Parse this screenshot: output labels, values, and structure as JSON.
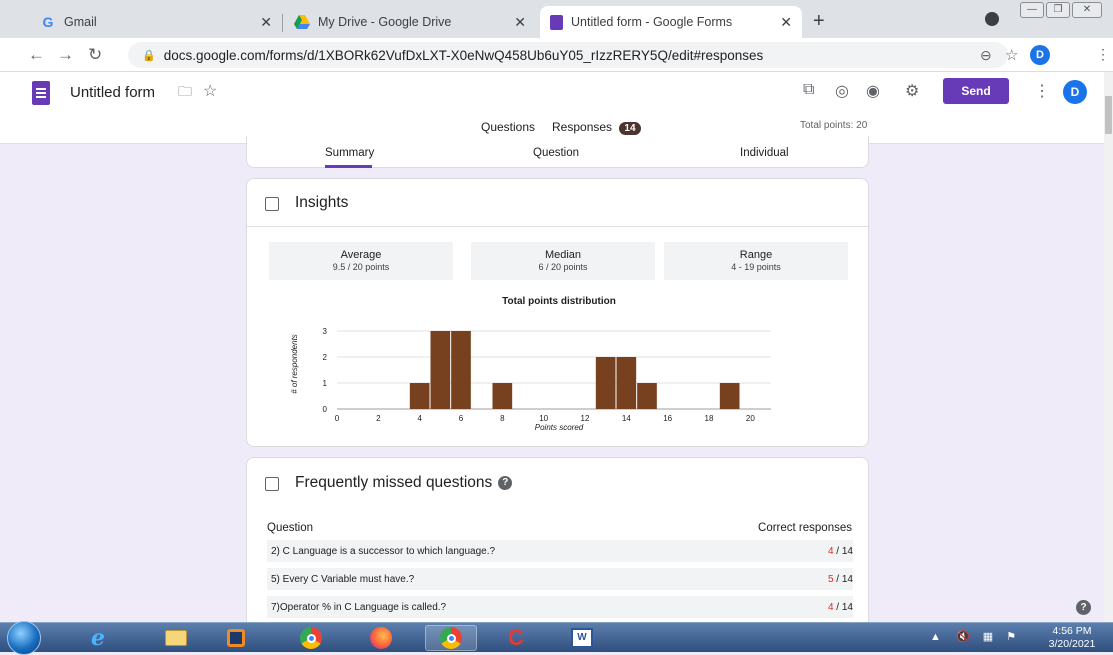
{
  "browser": {
    "tabs": [
      {
        "title": "Gmail"
      },
      {
        "title": "My Drive - Google Drive"
      },
      {
        "title": "Untitled form - Google Forms"
      }
    ],
    "url": "docs.google.com/forms/d/1XBORk62VufDxLXT-X0eNwQ458Ub6uY05_rIzzRERY5Q/edit#responses",
    "profile_initial": "D"
  },
  "forms_header": {
    "form_title": "Untitled form",
    "send_label": "Send",
    "profile_initial": "D",
    "tabs": {
      "questions": "Questions",
      "responses": "Responses",
      "responses_count": "14"
    },
    "total_points": "Total points: 20"
  },
  "response_tabs": {
    "summary": "Summary",
    "question": "Question",
    "individual": "Individual"
  },
  "insights": {
    "title": "Insights",
    "stats": [
      {
        "label": "Average",
        "value": "9.5 / 20 points"
      },
      {
        "label": "Median",
        "value": "6 / 20 points"
      },
      {
        "label": "Range",
        "value": "4 - 19 points"
      }
    ]
  },
  "chart_data": {
    "type": "bar",
    "title": "Total points distribution",
    "xlabel": "Points scored",
    "ylabel": "# of respondents",
    "x": [
      4,
      5,
      6,
      8,
      13,
      14,
      15,
      19
    ],
    "values": [
      1,
      3,
      3,
      1,
      2,
      2,
      1,
      1
    ],
    "xlim": [
      0,
      21
    ],
    "ylim": [
      0,
      3
    ],
    "xticks": [
      0,
      2,
      4,
      6,
      8,
      10,
      12,
      14,
      16,
      18,
      20
    ],
    "yticks": [
      0,
      1,
      2,
      3
    ],
    "bar_color": "#77401f"
  },
  "missed": {
    "title": "Frequently missed questions",
    "col_question": "Question",
    "col_correct": "Correct responses",
    "rows": [
      {
        "question": "2) C Language is a successor to which language.?",
        "correct": "4",
        "total": " / 14"
      },
      {
        "question": "5) Every C Variable must have.?",
        "correct": "5",
        "total": " / 14"
      },
      {
        "question": "7)Operator % in C Language is called.?",
        "correct": "4",
        "total": " / 14"
      }
    ]
  },
  "taskbar": {
    "time": "4:56 PM",
    "date": "3/20/2021"
  },
  "colors": {
    "accent": "#673ab7",
    "bar": "#77401f",
    "error": "#d93025"
  }
}
